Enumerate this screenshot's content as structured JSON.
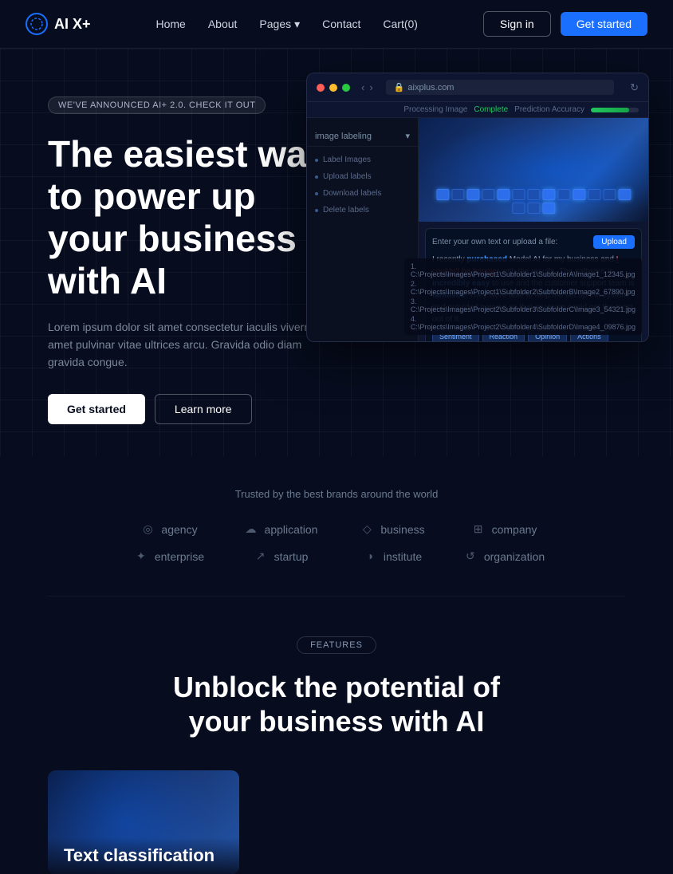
{
  "nav": {
    "logo": "AI X+",
    "links": [
      "Home",
      "About",
      "Pages",
      "Contact",
      "Cart(0)"
    ],
    "pages_chevron": "▾",
    "signin": "Sign in",
    "get_started": "Get started"
  },
  "hero": {
    "announcement": "WE'VE ANNOUNCED AI+ 2.0. CHECK IT OUT",
    "title": "The easiest way to power up your business with AI",
    "subtitle": "Lorem ipsum dolor sit amet consectetur iaculis viverra amet pulvinar vitae ultrices arcu. Gravida odio diam gravida congue.",
    "btn_primary": "Get started",
    "btn_secondary": "Learn more"
  },
  "mockup": {
    "dots": [
      "red",
      "yellow",
      "green"
    ],
    "url": "aixplus.com",
    "processing": "Processing Image",
    "status": "Complete",
    "accuracy_label": "Prediction Accuracy",
    "sidebar_header": "image labeling",
    "sidebar_items": [
      "Label Images",
      "Upload labels",
      "Download labels",
      "Delete labels"
    ],
    "chat_label": "Enter your own text or upload a file:",
    "upload_btn": "Upload",
    "chat_text_1": "I recently ",
    "chat_highlight_purchased": "purchased",
    "chat_text_2": " Model AI for my business and ",
    "chat_highlight_couldnt": "I couldn't be happier",
    "chat_text_3": " with the results. The software is ",
    "chat_highlight_easy": "incredibly easy",
    "chat_text_4": " to use and the customer support team is ",
    "chat_highlight_fantastic": "fantastic",
    "chat_text_5": ". They were able to help me set up the system and provided training so that my team could get the most out of it.",
    "tags": [
      "Sentiment",
      "Reaction",
      "Opinion",
      "Actions"
    ],
    "files": [
      "1. C:\\Projects\\Images\\Project1\\Subfolder1\\SubfolderA\\Image1_12345.jpg",
      "2. C:\\Projects\\Images\\Project1\\Subfolder2\\SubfolderB\\Image2_67890.jpg",
      "3. C:\\Projects\\Images\\Project2\\Subfolder3\\SubfolderC\\Image3_54321.jpg",
      "4. C:\\Projects\\Images\\Project2\\Subfolder4\\SubfolderD\\Image4_09876.jpg"
    ]
  },
  "trusted": {
    "title": "Trusted by the best brands around the world",
    "brands": [
      {
        "icon": "◎",
        "name": "agency"
      },
      {
        "icon": "☁",
        "name": "application"
      },
      {
        "icon": "◇",
        "name": "business"
      },
      {
        "icon": "⊞",
        "name": "company"
      },
      {
        "icon": "✦",
        "name": "enterprise"
      },
      {
        "icon": "↗",
        "name": "startup"
      },
      {
        "icon": "◑",
        "name": "institute"
      },
      {
        "icon": "↺",
        "name": "organization"
      }
    ]
  },
  "features": {
    "badge": "FEATURES",
    "title_line1": "Unblock the potential of",
    "title_line2": "your business with AI"
  },
  "bottom_card": {
    "label": "Text classification"
  }
}
